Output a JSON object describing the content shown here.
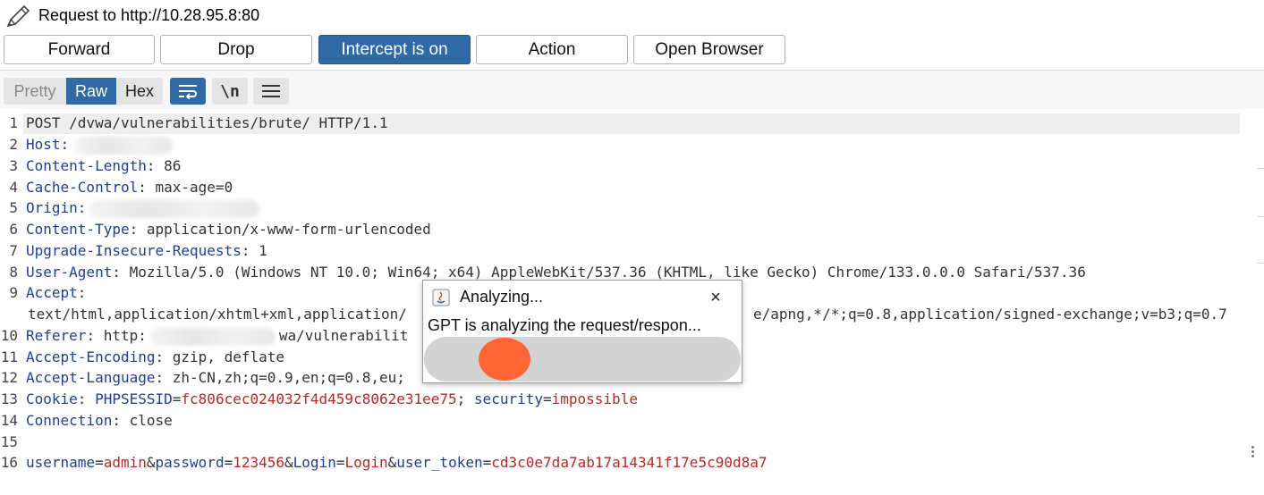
{
  "header": {
    "title": "Request to http://10.28.95.8:80",
    "buttons": {
      "forward": "Forward",
      "drop": "Drop",
      "intercept": "Intercept is on",
      "action": "Action",
      "open_browser": "Open Browser"
    }
  },
  "toolbar": {
    "pretty": "Pretty",
    "raw": "Raw",
    "hex": "Hex",
    "newline_glyph": "\\n",
    "icons": [
      "wrap-lines-icon",
      "newline-icon",
      "menu-icon"
    ]
  },
  "editor": {
    "line_numbers": [
      "1",
      "2",
      "3",
      "4",
      "5",
      "6",
      "7",
      "8",
      "9",
      "",
      "10",
      "11",
      "12",
      "13",
      "14",
      "15",
      "16"
    ],
    "l1": "POST /dvwa/vulnerabilities/brute/ HTTP/1.1",
    "l2_key": "Host:",
    "l3_key": "Content-Length",
    "l3_val": ": 86",
    "l4_key": "Cache-Control",
    "l4_val": ": max-age=0",
    "l5_key": "Origin:",
    "l6_key": "Content-Type",
    "l6_val": ": application/x-www-form-urlencoded",
    "l7_key": "Upgrade-Insecure-Requests",
    "l7_val": ": 1",
    "l8_key": "User-Agent",
    "l8_val": ": Mozilla/5.0 (Windows NT 10.0; Win64; x64) AppleWebKit/537.36 (KHTML, like Gecko) Chrome/133.0.0.0 Safari/537.36",
    "l9_key": "Accept",
    "l9_val": ":",
    "l9b_left": "text/html,application/xhtml+xml,application/",
    "l9b_right": "e/apng,*/*;q=0.8,application/signed-exchange;v=b3;q=0.7",
    "l10_key": "Referer",
    "l10_val": ": http:",
    "l10_tail": "wa/vulnerabilit",
    "l11_key": "Accept-Encoding",
    "l11_val": ": gzip, deflate",
    "l12_key": "Accept-Language",
    "l12_val": ": zh-CN,zh;q=0.9,en;q=0.8,eu;",
    "l13_key": "Cookie",
    "l13_sep": ": ",
    "l13_c1k": "PHPSESSID",
    "l13_eq1": "=",
    "l13_c1v": "fc806cec024032f4d459c8062e31ee75",
    "l13_semi": "; ",
    "l13_c2k": "security",
    "l13_eq2": "=",
    "l13_c2v": "impossible",
    "l14_key": "Connection",
    "l14_val": ": close",
    "l16_p1k": "username",
    "l16_p1v": "admin",
    "l16_p2k": "password",
    "l16_p2v": "123456",
    "l16_p3k": "Login",
    "l16_p3v": "Login",
    "l16_p4k": "user_token",
    "l16_p4v": "cd3c0e7da7ab17a14341f17e5c90d8a7",
    "amp": "&",
    "eq": "="
  },
  "dialog": {
    "title": "Analyzing...",
    "close": "×",
    "message": "GPT is analyzing the request/respon...",
    "progress_marker_fraction": 0.17,
    "accent": "#ff6634"
  },
  "colors": {
    "primary": "#2f6aa7",
    "header_key": "#1f3f8f",
    "param_value": "#b42a2a"
  }
}
